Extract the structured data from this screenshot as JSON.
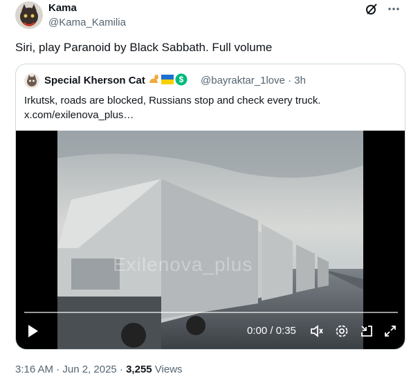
{
  "tweet": {
    "author_name": "Kama",
    "author_handle": "@Kama_Kamilia",
    "text": "Siri, play Paranoid by Black Sabbath. Full volume",
    "timestamp": "3:16 AM · Jun 2, 2025 · ",
    "views_count": "3,255",
    "views_label": " Views"
  },
  "header_icons": [
    "grok-icon",
    "more-icon"
  ],
  "quote": {
    "author_name": "Special Kherson Cat",
    "author_badges": [
      "cat-emoji",
      "ukraine-flag-emoji",
      "verified-money-badge"
    ],
    "handle_time": "@bayraktar_1love · 3h",
    "text_line1": "Irkutsk, roads are blocked, Russians stop and check every truck.",
    "text_line2": "x.com/exilenova_plus…"
  },
  "video": {
    "watermark": "Exilenova_plus",
    "time": "0:00 / 0:35",
    "progress": 0,
    "controls": [
      "play-icon",
      "volume-icon",
      "settings-icon",
      "exit-icon",
      "fullscreen-icon"
    ]
  },
  "colors": {
    "text": "#0f1419",
    "secondary": "#536471",
    "border": "#cfd9de",
    "verified": "#00ba7c"
  }
}
